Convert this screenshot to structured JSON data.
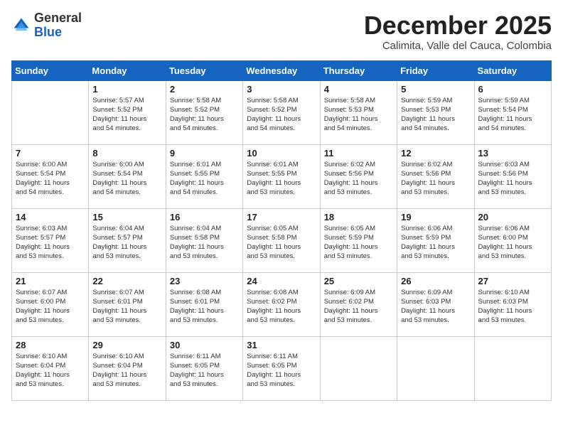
{
  "logo": {
    "general": "General",
    "blue": "Blue"
  },
  "title": "December 2025",
  "location": "Calimita, Valle del Cauca, Colombia",
  "days_header": [
    "Sunday",
    "Monday",
    "Tuesday",
    "Wednesday",
    "Thursday",
    "Friday",
    "Saturday"
  ],
  "weeks": [
    [
      {
        "day": "",
        "info": ""
      },
      {
        "day": "1",
        "info": "Sunrise: 5:57 AM\nSunset: 5:52 PM\nDaylight: 11 hours\nand 54 minutes."
      },
      {
        "day": "2",
        "info": "Sunrise: 5:58 AM\nSunset: 5:52 PM\nDaylight: 11 hours\nand 54 minutes."
      },
      {
        "day": "3",
        "info": "Sunrise: 5:58 AM\nSunset: 5:52 PM\nDaylight: 11 hours\nand 54 minutes."
      },
      {
        "day": "4",
        "info": "Sunrise: 5:58 AM\nSunset: 5:53 PM\nDaylight: 11 hours\nand 54 minutes."
      },
      {
        "day": "5",
        "info": "Sunrise: 5:59 AM\nSunset: 5:53 PM\nDaylight: 11 hours\nand 54 minutes."
      },
      {
        "day": "6",
        "info": "Sunrise: 5:59 AM\nSunset: 5:54 PM\nDaylight: 11 hours\nand 54 minutes."
      }
    ],
    [
      {
        "day": "7",
        "info": "Sunrise: 6:00 AM\nSunset: 5:54 PM\nDaylight: 11 hours\nand 54 minutes."
      },
      {
        "day": "8",
        "info": "Sunrise: 6:00 AM\nSunset: 5:54 PM\nDaylight: 11 hours\nand 54 minutes."
      },
      {
        "day": "9",
        "info": "Sunrise: 6:01 AM\nSunset: 5:55 PM\nDaylight: 11 hours\nand 54 minutes."
      },
      {
        "day": "10",
        "info": "Sunrise: 6:01 AM\nSunset: 5:55 PM\nDaylight: 11 hours\nand 53 minutes."
      },
      {
        "day": "11",
        "info": "Sunrise: 6:02 AM\nSunset: 5:56 PM\nDaylight: 11 hours\nand 53 minutes."
      },
      {
        "day": "12",
        "info": "Sunrise: 6:02 AM\nSunset: 5:56 PM\nDaylight: 11 hours\nand 53 minutes."
      },
      {
        "day": "13",
        "info": "Sunrise: 6:03 AM\nSunset: 5:56 PM\nDaylight: 11 hours\nand 53 minutes."
      }
    ],
    [
      {
        "day": "14",
        "info": "Sunrise: 6:03 AM\nSunset: 5:57 PM\nDaylight: 11 hours\nand 53 minutes."
      },
      {
        "day": "15",
        "info": "Sunrise: 6:04 AM\nSunset: 5:57 PM\nDaylight: 11 hours\nand 53 minutes."
      },
      {
        "day": "16",
        "info": "Sunrise: 6:04 AM\nSunset: 5:58 PM\nDaylight: 11 hours\nand 53 minutes."
      },
      {
        "day": "17",
        "info": "Sunrise: 6:05 AM\nSunset: 5:58 PM\nDaylight: 11 hours\nand 53 minutes."
      },
      {
        "day": "18",
        "info": "Sunrise: 6:05 AM\nSunset: 5:59 PM\nDaylight: 11 hours\nand 53 minutes."
      },
      {
        "day": "19",
        "info": "Sunrise: 6:06 AM\nSunset: 5:59 PM\nDaylight: 11 hours\nand 53 minutes."
      },
      {
        "day": "20",
        "info": "Sunrise: 6:06 AM\nSunset: 6:00 PM\nDaylight: 11 hours\nand 53 minutes."
      }
    ],
    [
      {
        "day": "21",
        "info": "Sunrise: 6:07 AM\nSunset: 6:00 PM\nDaylight: 11 hours\nand 53 minutes."
      },
      {
        "day": "22",
        "info": "Sunrise: 6:07 AM\nSunset: 6:01 PM\nDaylight: 11 hours\nand 53 minutes."
      },
      {
        "day": "23",
        "info": "Sunrise: 6:08 AM\nSunset: 6:01 PM\nDaylight: 11 hours\nand 53 minutes."
      },
      {
        "day": "24",
        "info": "Sunrise: 6:08 AM\nSunset: 6:02 PM\nDaylight: 11 hours\nand 53 minutes."
      },
      {
        "day": "25",
        "info": "Sunrise: 6:09 AM\nSunset: 6:02 PM\nDaylight: 11 hours\nand 53 minutes."
      },
      {
        "day": "26",
        "info": "Sunrise: 6:09 AM\nSunset: 6:03 PM\nDaylight: 11 hours\nand 53 minutes."
      },
      {
        "day": "27",
        "info": "Sunrise: 6:10 AM\nSunset: 6:03 PM\nDaylight: 11 hours\nand 53 minutes."
      }
    ],
    [
      {
        "day": "28",
        "info": "Sunrise: 6:10 AM\nSunset: 6:04 PM\nDaylight: 11 hours\nand 53 minutes."
      },
      {
        "day": "29",
        "info": "Sunrise: 6:10 AM\nSunset: 6:04 PM\nDaylight: 11 hours\nand 53 minutes."
      },
      {
        "day": "30",
        "info": "Sunrise: 6:11 AM\nSunset: 6:05 PM\nDaylight: 11 hours\nand 53 minutes."
      },
      {
        "day": "31",
        "info": "Sunrise: 6:11 AM\nSunset: 6:05 PM\nDaylight: 11 hours\nand 53 minutes."
      },
      {
        "day": "",
        "info": ""
      },
      {
        "day": "",
        "info": ""
      },
      {
        "day": "",
        "info": ""
      }
    ]
  ]
}
